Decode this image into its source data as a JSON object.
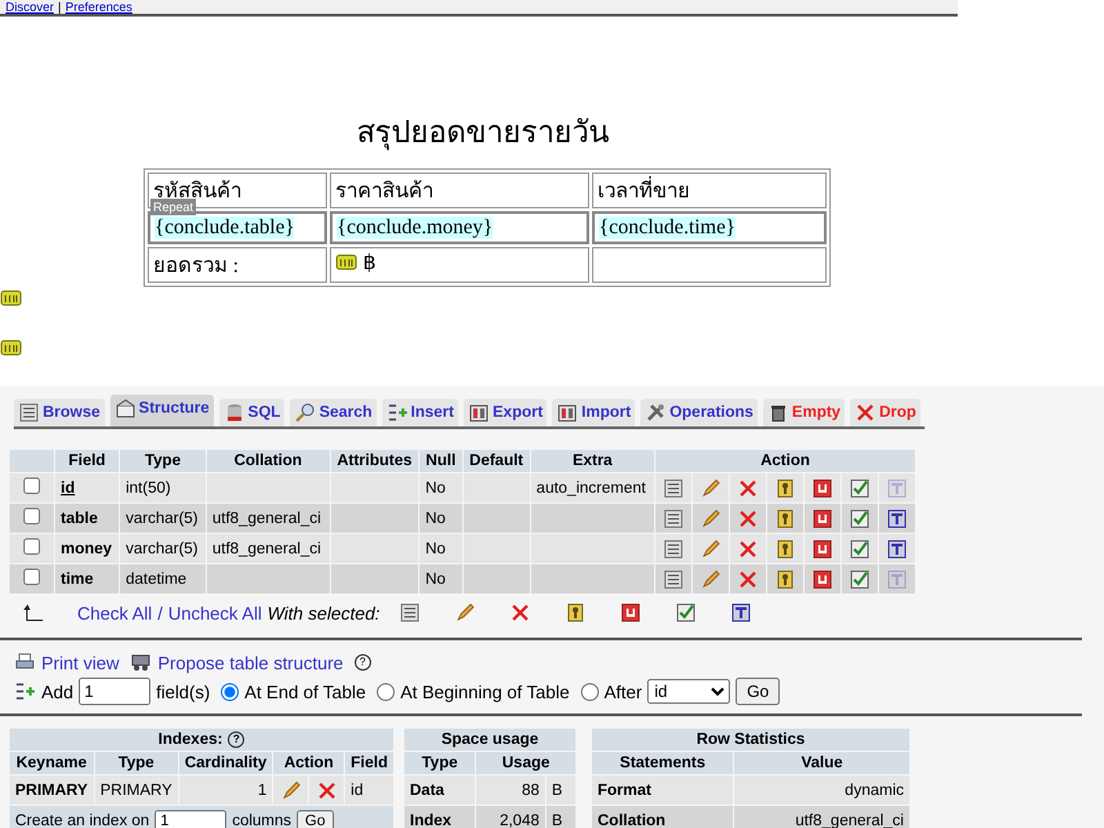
{
  "top_bar": {
    "links": [
      "Discover",
      "Preferences"
    ],
    "separator": "|"
  },
  "design": {
    "title": "สรุปยอดขายรายวัน",
    "headers": [
      "รหัสสินค้า",
      "ราคาสินค้า",
      "เวลาที่ขาย"
    ],
    "repeat_label": "Repeat",
    "repeat_row": [
      "{conclude.table}",
      "{conclude.money}",
      "{conclude.time}"
    ],
    "total_label": "ยอดรวม :",
    "total_currency": "฿"
  },
  "tabs": [
    {
      "label": "Browse",
      "kind": "browse",
      "danger": false,
      "selected": false
    },
    {
      "label": "Structure",
      "kind": "structure",
      "danger": false,
      "selected": true
    },
    {
      "label": "SQL",
      "kind": "sql",
      "danger": false,
      "selected": false
    },
    {
      "label": "Search",
      "kind": "search",
      "danger": false,
      "selected": false
    },
    {
      "label": "Insert",
      "kind": "insert",
      "danger": false,
      "selected": false
    },
    {
      "label": "Export",
      "kind": "export",
      "danger": false,
      "selected": false
    },
    {
      "label": "Import",
      "kind": "import",
      "danger": false,
      "selected": false
    },
    {
      "label": "Operations",
      "kind": "operations",
      "danger": false,
      "selected": false
    },
    {
      "label": "Empty",
      "kind": "empty",
      "danger": true,
      "selected": false
    },
    {
      "label": "Drop",
      "kind": "drop",
      "danger": true,
      "selected": false
    }
  ],
  "structure": {
    "columns": [
      "Field",
      "Type",
      "Collation",
      "Attributes",
      "Null",
      "Default",
      "Extra",
      "Action"
    ],
    "rows": [
      {
        "checked": false,
        "primary": true,
        "field": "id",
        "type": "int(50)",
        "null": "No",
        "extra": "auto_increment",
        "fulltext_enabled": false
      },
      {
        "checked": false,
        "primary": false,
        "field": "table",
        "type": "varchar(5)",
        "collation": "utf8_general_ci",
        "null": "No",
        "fulltext_enabled": true
      },
      {
        "checked": false,
        "primary": false,
        "field": "money",
        "type": "varchar(5)",
        "collation": "utf8_general_ci",
        "null": "No",
        "fulltext_enabled": true
      },
      {
        "checked": false,
        "primary": false,
        "field": "time",
        "type": "datetime",
        "null": "No",
        "fulltext_enabled": false
      }
    ],
    "check_links": [
      "Check All",
      "Uncheck All"
    ],
    "check_separator": "/",
    "with_selected": "With selected:"
  },
  "table_actions": {
    "print_view": "Print view",
    "propose": "Propose table structure",
    "help": "?"
  },
  "add_fields": {
    "label": "Add",
    "count": "1",
    "unit": "field(s)",
    "positions": [
      {
        "label": "At End of Table",
        "selected": true
      },
      {
        "label": "At Beginning of Table",
        "selected": false
      },
      {
        "label": "After",
        "selected": false
      }
    ],
    "after_field": "id",
    "button": "Go"
  },
  "indexes": {
    "title": "Indexes:",
    "help": "?",
    "columns": [
      "Keyname",
      "Type",
      "Cardinality",
      "Action",
      "Field"
    ],
    "rows": [
      {
        "keyname": "PRIMARY",
        "type": "PRIMARY",
        "cardinality": "1",
        "field": "id"
      }
    ],
    "create": {
      "label": "Create an index on",
      "count": "1",
      "unit": "columns",
      "button": "Go"
    }
  },
  "space_usage": {
    "title": "Space usage",
    "columns": [
      "Type",
      "Usage"
    ],
    "rows": [
      {
        "type": "Data",
        "usage": "88",
        "unit": "B"
      },
      {
        "type": "Index",
        "usage": "2,048",
        "unit": "B"
      }
    ]
  },
  "row_statistics": {
    "title": "Row Statistics",
    "columns": [
      "Statements",
      "Value"
    ],
    "rows": [
      {
        "statement": "Format",
        "value": "dynamic"
      },
      {
        "statement": "Collation",
        "value": "utf8_general_ci"
      }
    ]
  }
}
